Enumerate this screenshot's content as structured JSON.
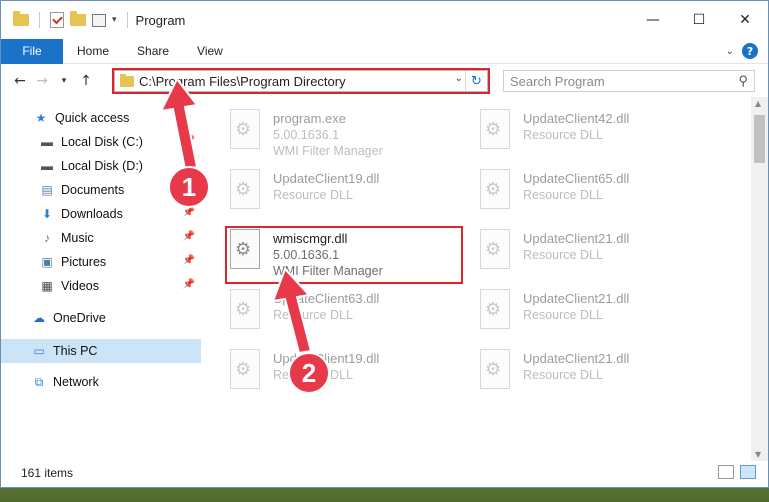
{
  "window": {
    "title": "Program"
  },
  "ribbon": {
    "file": "File",
    "tabs": [
      "Home",
      "Share",
      "View"
    ],
    "help": "?"
  },
  "address": {
    "path": "C:\\Program Files\\Program Directory"
  },
  "search": {
    "placeholder": "Search Program"
  },
  "sidebar": {
    "items": [
      {
        "label": "Quick access",
        "icon": "star-icon"
      },
      {
        "label": "Local Disk (C:)",
        "icon": "drive-icon",
        "pinned": true
      },
      {
        "label": "Local Disk (D:)",
        "icon": "drive-icon",
        "pinned": true
      },
      {
        "label": "Documents",
        "icon": "documents-icon",
        "pinned": true
      },
      {
        "label": "Downloads",
        "icon": "downloads-icon",
        "pinned": true
      },
      {
        "label": "Music",
        "icon": "music-icon",
        "pinned": true
      },
      {
        "label": "Pictures",
        "icon": "pictures-icon",
        "pinned": true
      },
      {
        "label": "Videos",
        "icon": "videos-icon",
        "pinned": true
      },
      {
        "label": "OneDrive",
        "icon": "cloud-icon"
      },
      {
        "label": "This PC",
        "icon": "pc-icon",
        "selected": true
      },
      {
        "label": "Network",
        "icon": "network-icon"
      }
    ]
  },
  "files": [
    {
      "name": "program.exe",
      "line2": "5.00.1636.1",
      "line3": "WMI Filter Manager"
    },
    {
      "name": "UpdateClient42.dll",
      "line2": "Resource DLL"
    },
    {
      "name": "UpdateClient19.dll",
      "line2": "Resource DLL"
    },
    {
      "name": "UpdateClient65.dll",
      "line2": "Resource DLL"
    },
    {
      "name": "wmiscmgr.dll",
      "line2": "5.00.1636.1",
      "line3": "WMI Filter Manager"
    },
    {
      "name": "UpdateClient21.dll",
      "line2": "Resource DLL"
    },
    {
      "name": "UpdateClient63.dll",
      "line2": "Resource DLL"
    },
    {
      "name": "UpdateClient21.dll",
      "line2": "Resource DLL"
    },
    {
      "name": "UpdateClient19.dll",
      "line2": "Resource DLL"
    },
    {
      "name": "UpdateClient21.dll",
      "line2": "Resource DLL"
    }
  ],
  "status": {
    "count": "161 items"
  },
  "callouts": [
    {
      "number": "1"
    },
    {
      "number": "2"
    }
  ],
  "colors": {
    "accent": "#1a73c8",
    "highlight": "#d9262f",
    "selected": "#cce4f7"
  }
}
